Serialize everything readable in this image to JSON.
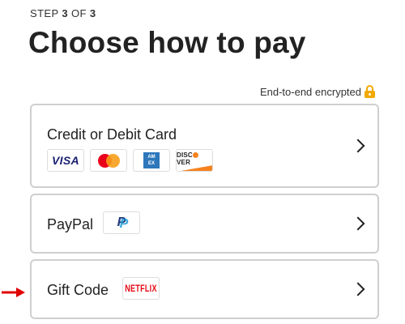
{
  "header": {
    "step_prefix": "STEP ",
    "step_current": "3",
    "step_mid": " OF ",
    "step_total": "3",
    "title": "Choose how to pay"
  },
  "encryption": {
    "label": "End-to-end encrypted",
    "icon": "lock-icon"
  },
  "options": {
    "credit_card": {
      "label": "Credit or Debit Card",
      "logos": {
        "visa": "VISA",
        "amex_top": "AM",
        "amex_bottom": "EX",
        "discover_pre": "DISC",
        "discover_post": "VER"
      }
    },
    "paypal": {
      "label": "PayPal",
      "logo": "P"
    },
    "gift_code": {
      "label": "Gift Code",
      "logo": "NETFLIX"
    }
  },
  "colors": {
    "accent_lock": "#f2a900",
    "border": "#cfcfcf",
    "arrow": "#e00000"
  }
}
